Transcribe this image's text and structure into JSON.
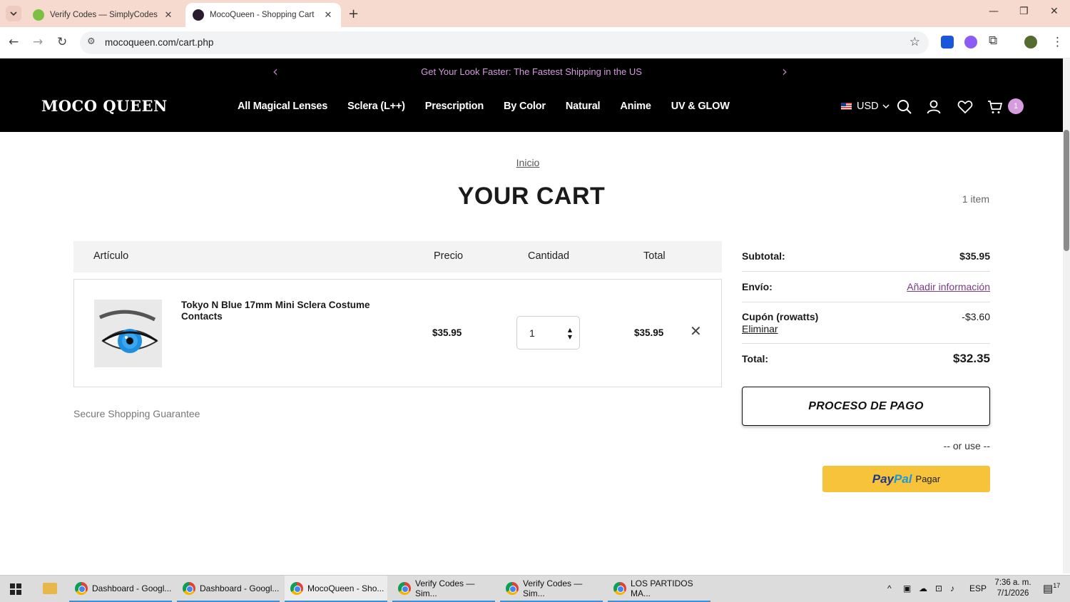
{
  "browser": {
    "tabs": [
      {
        "title": "Verify Codes — SimplyCodes",
        "active": false
      },
      {
        "title": "MocoQueen - Shopping Cart",
        "active": true
      }
    ],
    "url": "mocoqueen.com/cart.php"
  },
  "site": {
    "announcement": "Get Your Look Faster: The Fastest Shipping in the US",
    "logo": "MOCO QUEEN",
    "nav": [
      "All Magical Lenses",
      "Sclera (L++)",
      "Prescription",
      "By Color",
      "Natural",
      "Anime",
      "UV & GLOW"
    ],
    "currency": "USD",
    "cart_count": "1"
  },
  "cart": {
    "breadcrumb": "Inicio",
    "title": "YOUR CART",
    "item_count": "1 item",
    "headers": {
      "article": "Artículo",
      "price": "Precio",
      "quantity": "Cantidad",
      "total": "Total"
    },
    "items": [
      {
        "name": "Tokyo N Blue 17mm Mini Sclera Costume Contacts",
        "price": "$35.95",
        "quantity": "1",
        "total": "$35.95"
      }
    ],
    "secure_text": "Secure Shopping Guarantee"
  },
  "summary": {
    "subtotal_label": "Subtotal:",
    "subtotal_value": "$35.95",
    "shipping_label": "Envío:",
    "shipping_value": "Añadir información",
    "coupon_label": "Cupón (rowatts)",
    "coupon_remove": "Eliminar",
    "coupon_value": "-$3.60",
    "total_label": "Total:",
    "total_value": "$32.35",
    "checkout_label": "PROCESO DE PAGO",
    "or_use": "-- or use --",
    "paypal_pay": "PayPal",
    "paypal_pal": "Pal",
    "paypal_label": "Pagar"
  },
  "taskbar": {
    "apps": [
      {
        "title": "Dashboard - Googl...",
        "active": false
      },
      {
        "title": "Dashboard - Googl...",
        "active": false
      },
      {
        "title": "MocoQueen - Sho...",
        "active": true
      },
      {
        "title": "Verify Codes — Sim...",
        "active": false
      },
      {
        "title": "Verify Codes — Sim...",
        "active": false
      },
      {
        "title": "LOS PARTIDOS MA...",
        "active": false
      }
    ],
    "language": "ESP",
    "time": "7:36 a. m.",
    "date": "7/1/2026",
    "notifications": "17"
  },
  "colors": {
    "accent": "#d79be0",
    "paypal": "#f6c33b",
    "header_bg": "#000000"
  }
}
